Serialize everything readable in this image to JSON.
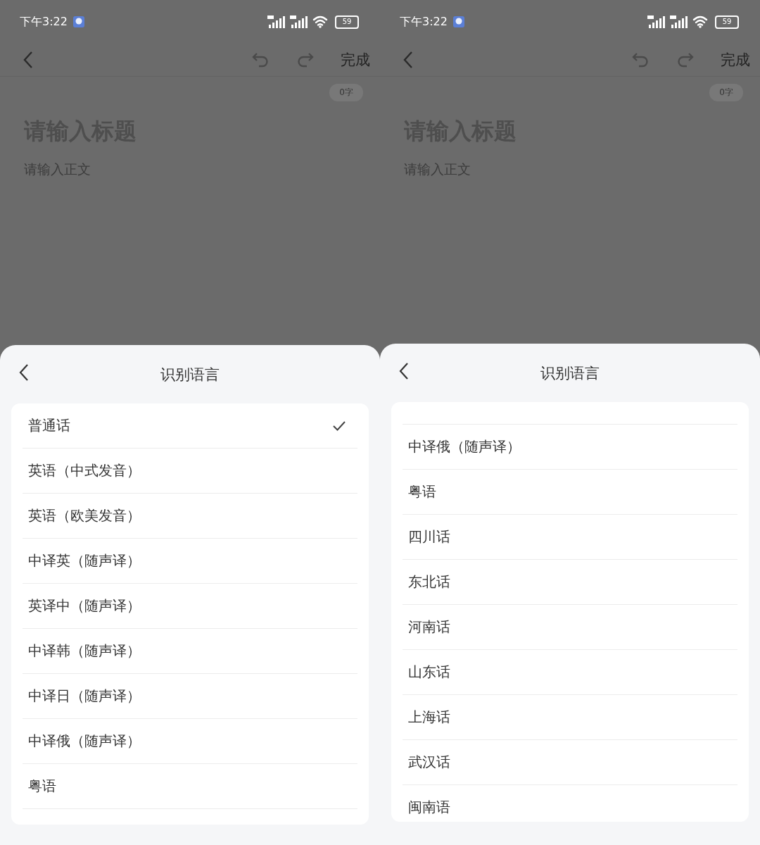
{
  "screens": [
    {
      "status_bar": {
        "time": "下午3:22",
        "battery": "59"
      },
      "toolbar": {
        "done": "完成"
      },
      "editor": {
        "word_count": "0字",
        "title_placeholder": "请输入标题",
        "body_placeholder": "请输入正文"
      },
      "sheet": {
        "title": "识别语言",
        "items": [
          {
            "label": "普通话",
            "selected": true
          },
          {
            "label": "英语（中式发音）",
            "selected": false
          },
          {
            "label": "英语（欧美发音）",
            "selected": false
          },
          {
            "label": "中译英（随声译）",
            "selected": false
          },
          {
            "label": "英译中（随声译）",
            "selected": false
          },
          {
            "label": "中译韩（随声译）",
            "selected": false
          },
          {
            "label": "中译日（随声译）",
            "selected": false
          },
          {
            "label": "中译俄（随声译）",
            "selected": false
          },
          {
            "label": "粤语",
            "selected": false
          }
        ]
      }
    },
    {
      "status_bar": {
        "time": "下午3:22",
        "battery": "59"
      },
      "toolbar": {
        "done": "完成"
      },
      "editor": {
        "word_count": "0字",
        "title_placeholder": "请输入标题",
        "body_placeholder": "请输入正文"
      },
      "sheet": {
        "title": "识别语言",
        "items": [
          {
            "label": "中译俄（随声译）",
            "selected": false
          },
          {
            "label": "粤语",
            "selected": false
          },
          {
            "label": "四川话",
            "selected": false
          },
          {
            "label": "东北话",
            "selected": false
          },
          {
            "label": "河南话",
            "selected": false
          },
          {
            "label": "山东话",
            "selected": false
          },
          {
            "label": "上海话",
            "selected": false
          },
          {
            "label": "武汉话",
            "selected": false
          },
          {
            "label": "闽南语",
            "selected": false
          }
        ]
      }
    }
  ]
}
